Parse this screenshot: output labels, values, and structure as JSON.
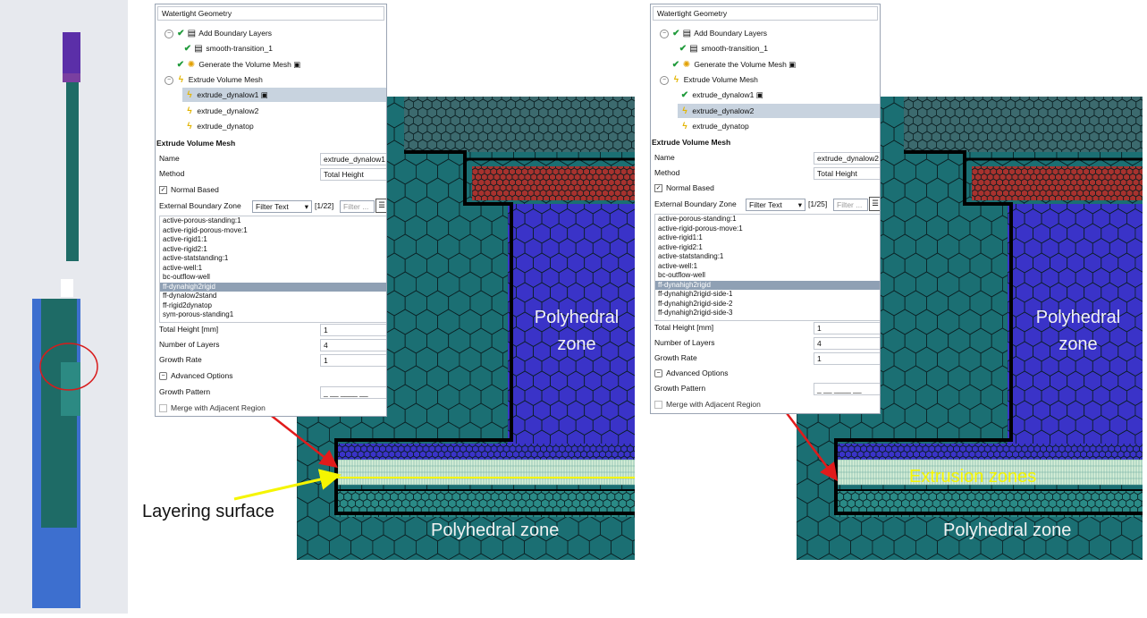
{
  "colors": {
    "mesh_teal": "#1b6f73",
    "mesh_blue": "#3a33c8",
    "mesh_red": "#a8322e",
    "arrow_red": "#e11b1b",
    "arrow_yellow": "#f5f500",
    "circle_red": "#d81b1b",
    "geometry_blue": "#3d6fcf",
    "geometry_teal": "#1e6b66",
    "geometry_purple": "#5b2fa8",
    "selection_bg": "#c8d3df"
  },
  "panel1": {
    "header": "Watertight Geometry",
    "tree": [
      {
        "label": "Add Boundary Layers",
        "status": "check",
        "expander": "⊖"
      },
      {
        "label": "smooth-transition_1",
        "status": "check"
      },
      {
        "label": "Generate the Volume Mesh",
        "status": "check"
      },
      {
        "label": "Extrude Volume Mesh",
        "status": "bolt",
        "expander": "⊖"
      },
      {
        "label": "extrude_dynalow1",
        "status": "bolt",
        "selected": true
      },
      {
        "label": "extrude_dynalow2",
        "status": "bolt"
      },
      {
        "label": "extrude_dynatop",
        "status": "bolt"
      }
    ],
    "section_title": "Extrude Volume Mesh",
    "name_label": "Name",
    "name_value": "extrude_dynalow1",
    "method_label": "Method",
    "method_value": "Total Height",
    "normal_based_label": "Normal Based",
    "ext_zone_label": "External Boundary Zone",
    "filter_dropdown": "Filter Text",
    "count": "[1/22]",
    "filter_placeholder": "Filter ...",
    "zones": [
      "active-porous-standing:1",
      "active-rigid-porous-move:1",
      "active-rigid1:1",
      "active-rigid2:1",
      "active-statstanding:1",
      "active-well:1",
      "bc-outflow-well",
      "ff-dynahigh2rigid",
      "ff-dynalow2stand",
      "ff-rigid2dynatop",
      "sym-porous-standing1"
    ],
    "selected_zone_index": 7,
    "total_height_label": "Total Height [mm]",
    "total_height_value": "1",
    "num_layers_label": "Number of Layers",
    "num_layers_value": "4",
    "growth_rate_label": "Growth Rate",
    "growth_rate_value": "1",
    "advanced_label": "Advanced Options",
    "growth_pattern_label": "Growth Pattern",
    "merge_label": "Merge with Adjacent Region"
  },
  "panel2": {
    "header": "Watertight Geometry",
    "tree": [
      {
        "label": "Add Boundary Layers",
        "status": "check",
        "expander": "⊖"
      },
      {
        "label": "smooth-transition_1",
        "status": "check"
      },
      {
        "label": "Generate the Volume Mesh",
        "status": "check"
      },
      {
        "label": "Extrude Volume Mesh",
        "status": "bolt",
        "expander": "⊖"
      },
      {
        "label": "extrude_dynalow1",
        "status": "check"
      },
      {
        "label": "extrude_dynalow2",
        "status": "bolt",
        "selected": true
      },
      {
        "label": "extrude_dynatop",
        "status": "bolt"
      }
    ],
    "section_title": "Extrude Volume Mesh",
    "name_label": "Name",
    "name_value": "extrude_dynalow2",
    "method_label": "Method",
    "method_value": "Total Height",
    "normal_based_label": "Normal Based",
    "ext_zone_label": "External Boundary Zone",
    "filter_dropdown": "Filter Text",
    "count": "[1/25]",
    "filter_placeholder": "Filter ...",
    "zones": [
      "active-porous-standing:1",
      "active-rigid-porous-move:1",
      "active-rigid1:1",
      "active-rigid2:1",
      "active-statstanding:1",
      "active-well:1",
      "bc-outflow-well",
      "ff-dynahigh2rigid",
      "ff-dynahigh2rigid-side-1",
      "ff-dynahigh2rigid-side-2",
      "ff-dynahigh2rigid-side-3"
    ],
    "selected_zone_index": 7,
    "total_height_label": "Total Height [mm]",
    "total_height_value": "1",
    "num_layers_label": "Number of Layers",
    "num_layers_value": "4",
    "growth_rate_label": "Growth Rate",
    "growth_rate_value": "1",
    "advanced_label": "Advanced Options",
    "growth_pattern_label": "Growth Pattern",
    "merge_label": "Merge with Adjacent Region"
  },
  "mesh1": {
    "poly_upper_l1": "Polyhedral",
    "poly_upper_l2": "zone",
    "poly_lower": "Polyhedral zone"
  },
  "mesh2": {
    "poly_upper_l1": "Polyhedral",
    "poly_upper_l2": "zone",
    "poly_lower": "Polyhedral zone",
    "extrusion": "Extrusion zones"
  },
  "layering_caption": "Layering surface"
}
